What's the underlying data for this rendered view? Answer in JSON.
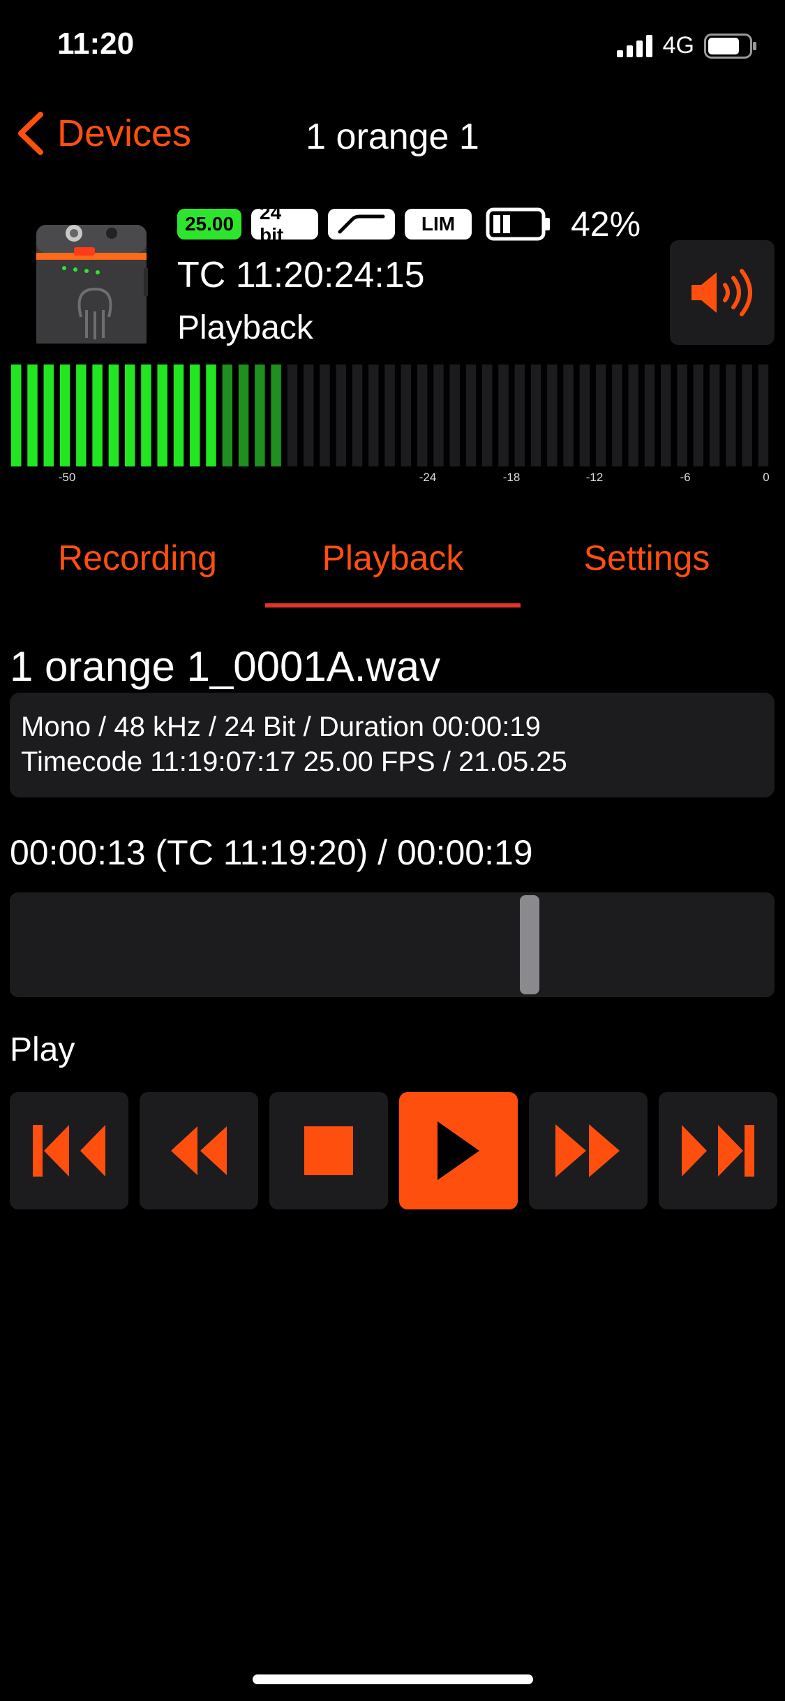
{
  "status_bar": {
    "time": "11:20",
    "network": "4G"
  },
  "nav": {
    "back_label": "Devices",
    "title": "1 orange 1"
  },
  "device": {
    "badges": {
      "fps": "25.00",
      "bit_depth": "24 bit",
      "limiter": "LIM"
    },
    "battery_percent": "42%",
    "timecode": "TC 11:20:24:15",
    "mode": "Playback"
  },
  "meter": {
    "labels": [
      "-50",
      "-24",
      "-18",
      "-12",
      "-6",
      "0"
    ],
    "total_bars": 47,
    "bright_bars": 13,
    "dim_bars": 4,
    "colors": {
      "bright": "#22e622",
      "dim": "#1f8f1f",
      "off": "#1c1c1e"
    }
  },
  "tabs": [
    {
      "label": "Recording",
      "active": false
    },
    {
      "label": "Playback",
      "active": true
    },
    {
      "label": "Settings",
      "active": false
    }
  ],
  "file": {
    "name": "1 orange 1_0001A.wav",
    "info_line1": "Mono / 48 kHz / 24 Bit / Duration 00:00:19",
    "info_line2": "Timecode 11:19:07:17 25.00 FPS / 21.05.25"
  },
  "position": {
    "text": "00:00:13 (TC 11:19:20) / 00:00:19",
    "fraction": 0.684
  },
  "transport": {
    "label": "Play",
    "buttons": [
      "skip-to-start",
      "rewind",
      "stop",
      "play",
      "fast-forward",
      "skip-to-end"
    ],
    "active": "play"
  },
  "colors": {
    "accent": "#ff4f0f",
    "surface": "#1c1c1e",
    "fps_badge": "#2ee52e"
  }
}
